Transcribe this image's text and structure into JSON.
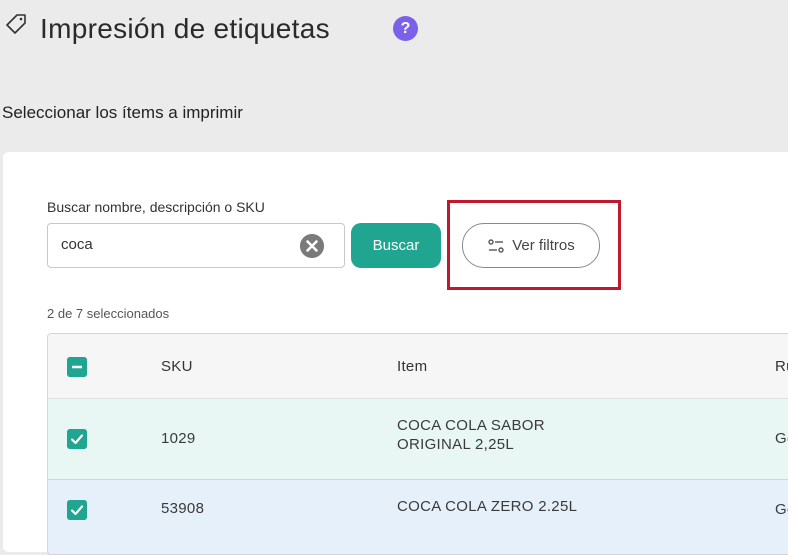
{
  "header": {
    "title": "Impresión de etiquetas",
    "help_symbol": "?"
  },
  "section": {
    "title": "Seleccionar los ítems a imprimir"
  },
  "search": {
    "label": "Buscar nombre, descripción o SKU",
    "value": "coca",
    "button_label": "Buscar"
  },
  "filters": {
    "button_label": "Ver filtros"
  },
  "selection": {
    "count_text": "2 de 7 seleccionados"
  },
  "table": {
    "columns": [
      "SKU",
      "Item",
      "Ru"
    ],
    "rows": [
      {
        "sku": "1029",
        "item_line1": "COCA COLA SABOR",
        "item_line2": "ORIGINAL 2,25L",
        "extra": "Ge",
        "checked": true
      },
      {
        "sku": "53908",
        "item_line1": "COCA COLA ZERO 2.25L",
        "item_line2": "",
        "extra": "Ge",
        "checked": true
      }
    ]
  },
  "colors": {
    "accent": "#1fa590",
    "help": "#7b61e8",
    "highlight": "#c0182c"
  }
}
